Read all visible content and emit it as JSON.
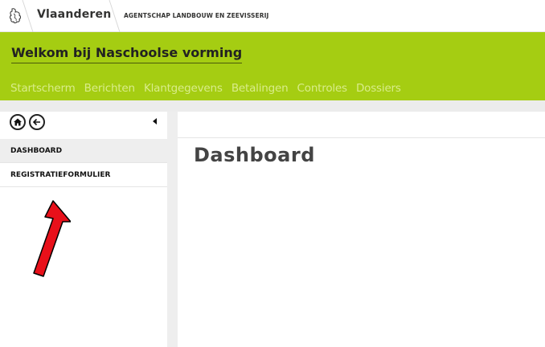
{
  "topbar": {
    "brand": "Vlaanderen",
    "agency": "AGENTSCHAP LANDBOUW EN ZEEVISSERIJ"
  },
  "header": {
    "title": "Welkom bij Naschoolse vorming",
    "nav": [
      "Startscherm",
      "Berichten",
      "Klantgegevens",
      "Betalingen",
      "Controles",
      "Dossiers"
    ]
  },
  "sidebar": {
    "items": [
      {
        "label": "DASHBOARD",
        "active": true
      },
      {
        "label": "REGISTRATIEFORMULIER",
        "active": false
      }
    ],
    "icons": [
      "home-icon",
      "back-arrow-icon",
      "collapse-triangle-icon"
    ]
  },
  "main": {
    "title": "Dashboard"
  },
  "colors": {
    "header_green": "#a5cd12",
    "nav_text": "#d9ec8a",
    "annotation_red": "#e8101a"
  }
}
